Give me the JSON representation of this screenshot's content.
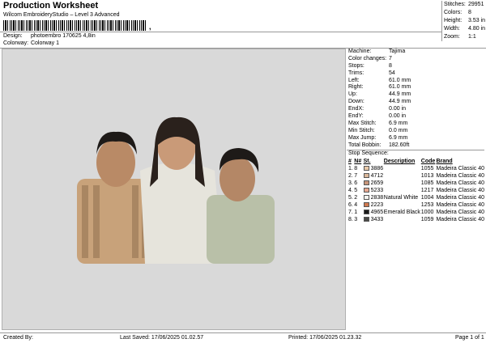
{
  "header": {
    "title": "Production Worksheet",
    "subtitle": "Wilcom EmbroideryStudio – Level 3 Advanced",
    "barcode_mark": ","
  },
  "info": {
    "design_label": "Design:",
    "design_value": "photoembro 170625 4,8in",
    "colorway_label": "Colorway:",
    "colorway_value": "Colorway 1"
  },
  "stats": [
    {
      "k": "Stitches:",
      "v": "29951"
    },
    {
      "k": "Colors:",
      "v": "8"
    },
    {
      "k": "Height:",
      "v": "3.53 in"
    },
    {
      "k": "Width:",
      "v": "4.80 in"
    },
    {
      "k": "Zoom:",
      "v": "1:1"
    }
  ],
  "details": [
    {
      "k": "Machine:",
      "v": "Tajima"
    },
    {
      "k": "Color changes:",
      "v": "7"
    },
    {
      "k": "Stops:",
      "v": "8"
    },
    {
      "k": "Trims:",
      "v": "54"
    },
    {
      "k": "Left:",
      "v": "61.0 mm"
    },
    {
      "k": "Right:",
      "v": "61.0 mm"
    },
    {
      "k": "Up:",
      "v": "44.9 mm"
    },
    {
      "k": "Down:",
      "v": "44.9 mm"
    },
    {
      "k": "EndX:",
      "v": "0.00 in"
    },
    {
      "k": "EndY:",
      "v": "0.00 in"
    },
    {
      "k": "Max Stitch:",
      "v": "6.9 mm"
    },
    {
      "k": "Min Stitch:",
      "v": "0.0 mm"
    },
    {
      "k": "Max Jump:",
      "v": "6.9 mm"
    },
    {
      "k": "Total Bobbin:",
      "v": "182.60ft"
    }
  ],
  "stop_sequence": {
    "title": "Stop Sequence:",
    "headers": {
      "num": "#",
      "n": "N#",
      "st": "St.",
      "desc": "Description",
      "code": "Code",
      "brand": "Brand"
    },
    "rows": [
      {
        "num": "1.",
        "n": "8",
        "color": "#e8c8a8",
        "st": "3886",
        "desc": "",
        "code": "1055",
        "brand": "Madeira Classic 40"
      },
      {
        "num": "2.",
        "n": "7",
        "color": "#d9b79a",
        "st": "4712",
        "desc": "",
        "code": "1013",
        "brand": "Madeira Classic 40"
      },
      {
        "num": "3.",
        "n": "6",
        "color": "#c8957a",
        "st": "2659",
        "desc": "",
        "code": "1085",
        "brand": "Madeira Classic 40"
      },
      {
        "num": "4.",
        "n": "5",
        "color": "#e8a890",
        "st": "5233",
        "desc": "",
        "code": "1217",
        "brand": "Madeira Classic 40"
      },
      {
        "num": "5.",
        "n": "2",
        "color": "#f5f5f0",
        "st": "2838",
        "desc": "Natural White",
        "code": "1004",
        "brand": "Madeira Classic 40"
      },
      {
        "num": "6.",
        "n": "4",
        "color": "#d0794f",
        "st": "2223",
        "desc": "",
        "code": "1253",
        "brand": "Madeira Classic 40"
      },
      {
        "num": "7.",
        "n": "1",
        "color": "#1a1a1a",
        "st": "4965",
        "desc": "Emerald Black",
        "code": "1000",
        "brand": "Madeira Classic 40"
      },
      {
        "num": "8.",
        "n": "3",
        "color": "#4a4a48",
        "st": "3433",
        "desc": "",
        "code": "1059",
        "brand": "Madeira Classic 40"
      }
    ]
  },
  "footer": {
    "created_by": "Created By:",
    "last_saved": "Last Saved: 17/06/2025 01.02.57",
    "printed": "Printed: 17/06/2025 01.23.32",
    "page": "Page 1 of 1"
  }
}
